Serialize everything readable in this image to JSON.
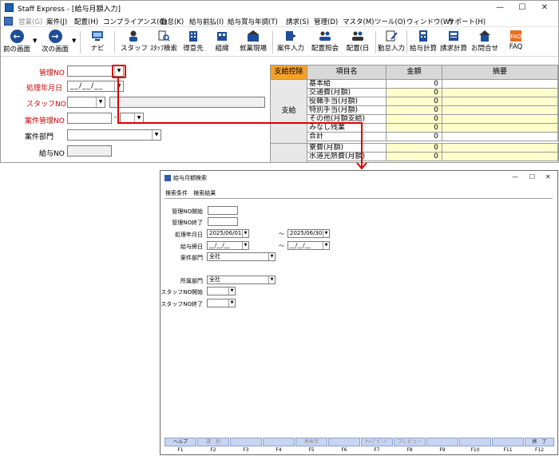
{
  "main_window": {
    "title": "Staff Express - [給与月額入力]",
    "controls": {
      "minimize": "—",
      "maximize": "☐",
      "close": "✕"
    },
    "menu": [
      "営業(G)",
      "案件(J)",
      "配置(H)",
      "コンプライアンス(C)",
      "勤怠(K)",
      "給与前払(I)",
      "給与賞与年調(T)",
      "請求(S)",
      "管理(D)",
      "マスタ(M)",
      "ツール(O)",
      "ウィンドウ(W)",
      "サポート(H)"
    ],
    "toolbar": [
      "前の画面",
      "次の画面",
      "ナビ",
      "スタッフ",
      "ｽﾀｯﾌ検索",
      "得意先",
      "組織",
      "就業現場",
      "案件入力",
      "配置照会",
      "配置(日",
      "勤怠入力",
      "給与計算",
      "請求計算",
      "お問合せ",
      "FAQ"
    ],
    "form": {
      "labels": [
        "管理NO",
        "処理年月日",
        "スタッフNO",
        "案件管理NO",
        "案件部門",
        "給与NO"
      ],
      "date_placeholder": "__/__/__",
      "dash": "-"
    },
    "pay_table": {
      "header_tab": "支給控除",
      "columns": [
        "項目名",
        "金額",
        "摘要"
      ],
      "group_label": "支給",
      "rows": [
        {
          "name": "基本給",
          "amount": "0"
        },
        {
          "name": "交通費(月額)",
          "amount": "0"
        },
        {
          "name": "役職手当(月額)",
          "amount": "0"
        },
        {
          "name": "特別手当(月額)",
          "amount": "0"
        },
        {
          "name": "その他(月額支給)",
          "amount": "0"
        },
        {
          "name": "みなし残業",
          "amount": "0"
        },
        {
          "name": "合計",
          "amount": "0"
        },
        {
          "name": "寮費(月額)",
          "amount": "0"
        },
        {
          "name": "水道光熱費(月額)",
          "amount": "0"
        }
      ]
    }
  },
  "sub_window": {
    "title": "給与月額検索",
    "controls": {
      "minimize": "—",
      "maximize": "☐",
      "close": "✕"
    },
    "tabs": [
      "検索条件",
      "検索結果"
    ],
    "fields": {
      "kanri_start": "管理NO開始",
      "kanri_end": "管理NO終了",
      "shori_label": "処理年月日",
      "shori_from": "2025/06/01",
      "shori_to": "2025/06/30",
      "kyuyo_label": "給与締日",
      "kyuyo_from": "__/__/__",
      "kyuyo_to": "__/__/__",
      "anken_bumon_label": "案件部門",
      "anken_bumon": "全社",
      "shozoku_label": "所属部門",
      "shozoku": "全社",
      "staff_start": "スタッフNO開始",
      "staff_end": "スタッフNO終了",
      "tilde": "〜"
    },
    "fkeys": [
      {
        "label": "ヘルプ",
        "key": "F1",
        "enabled": true
      },
      {
        "label": "選　択",
        "key": "F2",
        "enabled": false
      },
      {
        "label": "",
        "key": "F3",
        "enabled": false
      },
      {
        "label": "",
        "key": "F4",
        "enabled": false
      },
      {
        "label": "再表示",
        "key": "F5",
        "enabled": false
      },
      {
        "label": "",
        "key": "F6",
        "enabled": false
      },
      {
        "label": "ｸﾘｯﾌﾟﾎﾞｰﾄﾞ",
        "key": "F7",
        "enabled": false
      },
      {
        "label": "プレビュー",
        "key": "F8",
        "enabled": false
      },
      {
        "label": "",
        "key": "F9",
        "enabled": false
      },
      {
        "label": "",
        "key": "F10",
        "enabled": false
      },
      {
        "label": "",
        "key": "F11",
        "enabled": false
      },
      {
        "label": "終　了",
        "key": "F12",
        "enabled": true
      }
    ]
  },
  "colors": {
    "red_label": "#d00000",
    "highlight": "#d80000",
    "amount_bg": "#ffffcc",
    "header_orange": "#f7a02a",
    "fkey_bg": "#c8d5f0"
  }
}
